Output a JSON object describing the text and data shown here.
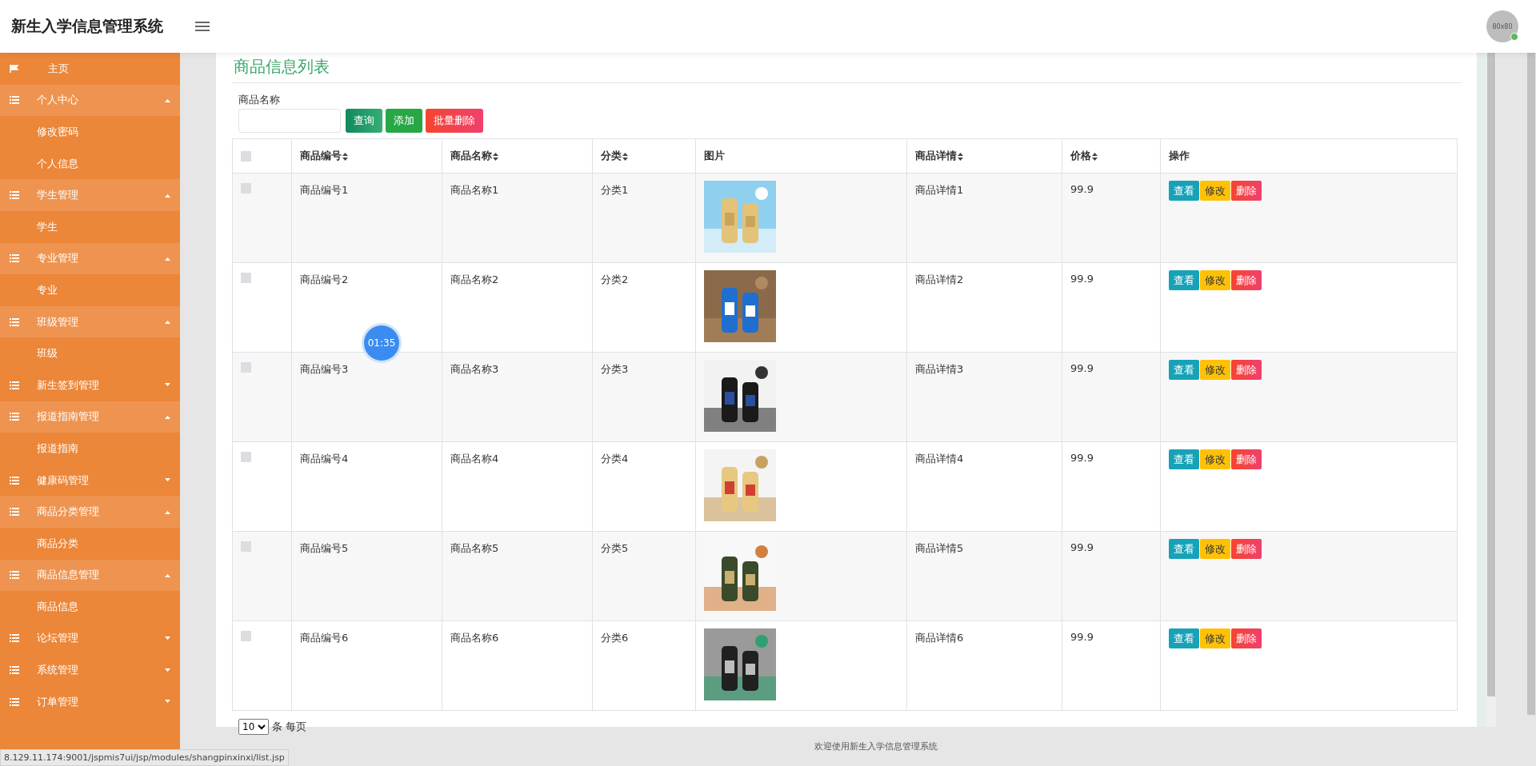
{
  "header": {
    "title": "新生入学信息管理系统",
    "avatar": "80x80",
    "online": true
  },
  "sidebar": {
    "items": [
      {
        "label": "主页",
        "kind": "home",
        "expanded": false
      },
      {
        "label": "个人中心",
        "kind": "group",
        "expanded": true,
        "children": [
          {
            "label": "修改密码"
          },
          {
            "label": "个人信息"
          }
        ]
      },
      {
        "label": "学生管理",
        "kind": "group",
        "expanded": true,
        "children": [
          {
            "label": "学生"
          }
        ]
      },
      {
        "label": "专业管理",
        "kind": "group",
        "expanded": true,
        "children": [
          {
            "label": "专业"
          }
        ]
      },
      {
        "label": "班级管理",
        "kind": "group",
        "expanded": true,
        "children": [
          {
            "label": "班级"
          }
        ]
      },
      {
        "label": "新生签到管理",
        "kind": "group",
        "expanded": false
      },
      {
        "label": "报道指南管理",
        "kind": "group",
        "expanded": true,
        "children": [
          {
            "label": "报道指南"
          }
        ]
      },
      {
        "label": "健康码管理",
        "kind": "group",
        "expanded": false
      },
      {
        "label": "商品分类管理",
        "kind": "group",
        "expanded": true,
        "children": [
          {
            "label": "商品分类"
          }
        ]
      },
      {
        "label": "商品信息管理",
        "kind": "group",
        "expanded": true,
        "children": [
          {
            "label": "商品信息"
          }
        ]
      },
      {
        "label": "论坛管理",
        "kind": "group",
        "expanded": false
      },
      {
        "label": "系统管理",
        "kind": "group",
        "expanded": false
      },
      {
        "label": "订单管理",
        "kind": "group",
        "expanded": false
      }
    ]
  },
  "page_title": "商品信息列表",
  "search": {
    "label": "商品名称",
    "buttons": [
      {
        "label": "查询",
        "kind": "search"
      },
      {
        "label": "添加",
        "kind": "add"
      },
      {
        "label": "批量删除",
        "kind": "delete"
      }
    ]
  },
  "table": {
    "select_all_checked": false,
    "columns": [
      {
        "label": "商品编号",
        "sortable": true
      },
      {
        "label": "商品名称",
        "sortable": true
      },
      {
        "label": "分类",
        "sortable": true
      },
      {
        "label": "图片",
        "sortable": false
      },
      {
        "label": "商品详情",
        "sortable": true
      },
      {
        "label": "价格",
        "sortable": true
      },
      {
        "label": "操作",
        "sortable": false
      }
    ],
    "rows": [
      {
        "checked": false,
        "code": "商品编号1",
        "name": "商品名称1",
        "category": "分类1",
        "detail": "商品详情1",
        "price": "99.9",
        "actions": [
          {
            "label": "查看",
            "kind": "view"
          },
          {
            "label": "修改",
            "kind": "edit"
          },
          {
            "label": "删除",
            "kind": "delete"
          }
        ]
      },
      {
        "checked": false,
        "code": "商品编号2",
        "name": "商品名称2",
        "category": "分类2",
        "detail": "商品详情2",
        "price": "99.9",
        "actions": [
          {
            "label": "查看",
            "kind": "view"
          },
          {
            "label": "修改",
            "kind": "edit"
          },
          {
            "label": "删除",
            "kind": "delete"
          }
        ]
      },
      {
        "checked": false,
        "code": "商品编号3",
        "name": "商品名称3",
        "category": "分类3",
        "detail": "商品详情3",
        "price": "99.9",
        "actions": [
          {
            "label": "查看",
            "kind": "view"
          },
          {
            "label": "修改",
            "kind": "edit"
          },
          {
            "label": "删除",
            "kind": "delete"
          }
        ]
      },
      {
        "checked": false,
        "code": "商品编号4",
        "name": "商品名称4",
        "category": "分类4",
        "detail": "商品详情4",
        "price": "99.9",
        "actions": [
          {
            "label": "查看",
            "kind": "view"
          },
          {
            "label": "修改",
            "kind": "edit"
          },
          {
            "label": "删除",
            "kind": "delete"
          }
        ]
      },
      {
        "checked": false,
        "code": "商品编号5",
        "name": "商品名称5",
        "category": "分类5",
        "detail": "商品详情5",
        "price": "99.9",
        "actions": [
          {
            "label": "查看",
            "kind": "view"
          },
          {
            "label": "修改",
            "kind": "edit"
          },
          {
            "label": "删除",
            "kind": "delete"
          }
        ]
      },
      {
        "checked": false,
        "code": "商品编号6",
        "name": "商品名称6",
        "category": "分类6",
        "detail": "商品详情6",
        "price": "99.9",
        "actions": [
          {
            "label": "查看",
            "kind": "view"
          },
          {
            "label": "修改",
            "kind": "edit"
          },
          {
            "label": "删除",
            "kind": "delete"
          }
        ]
      }
    ]
  },
  "pagination": {
    "page_size": "10",
    "label": "条 每页"
  },
  "timer": "01:35",
  "footer": "欢迎使用新生入学信息管理系统",
  "status_url": "8.129.11.174:9001/jspmis7ui/jsp/modules/shangpinxinxi/list.jsp"
}
